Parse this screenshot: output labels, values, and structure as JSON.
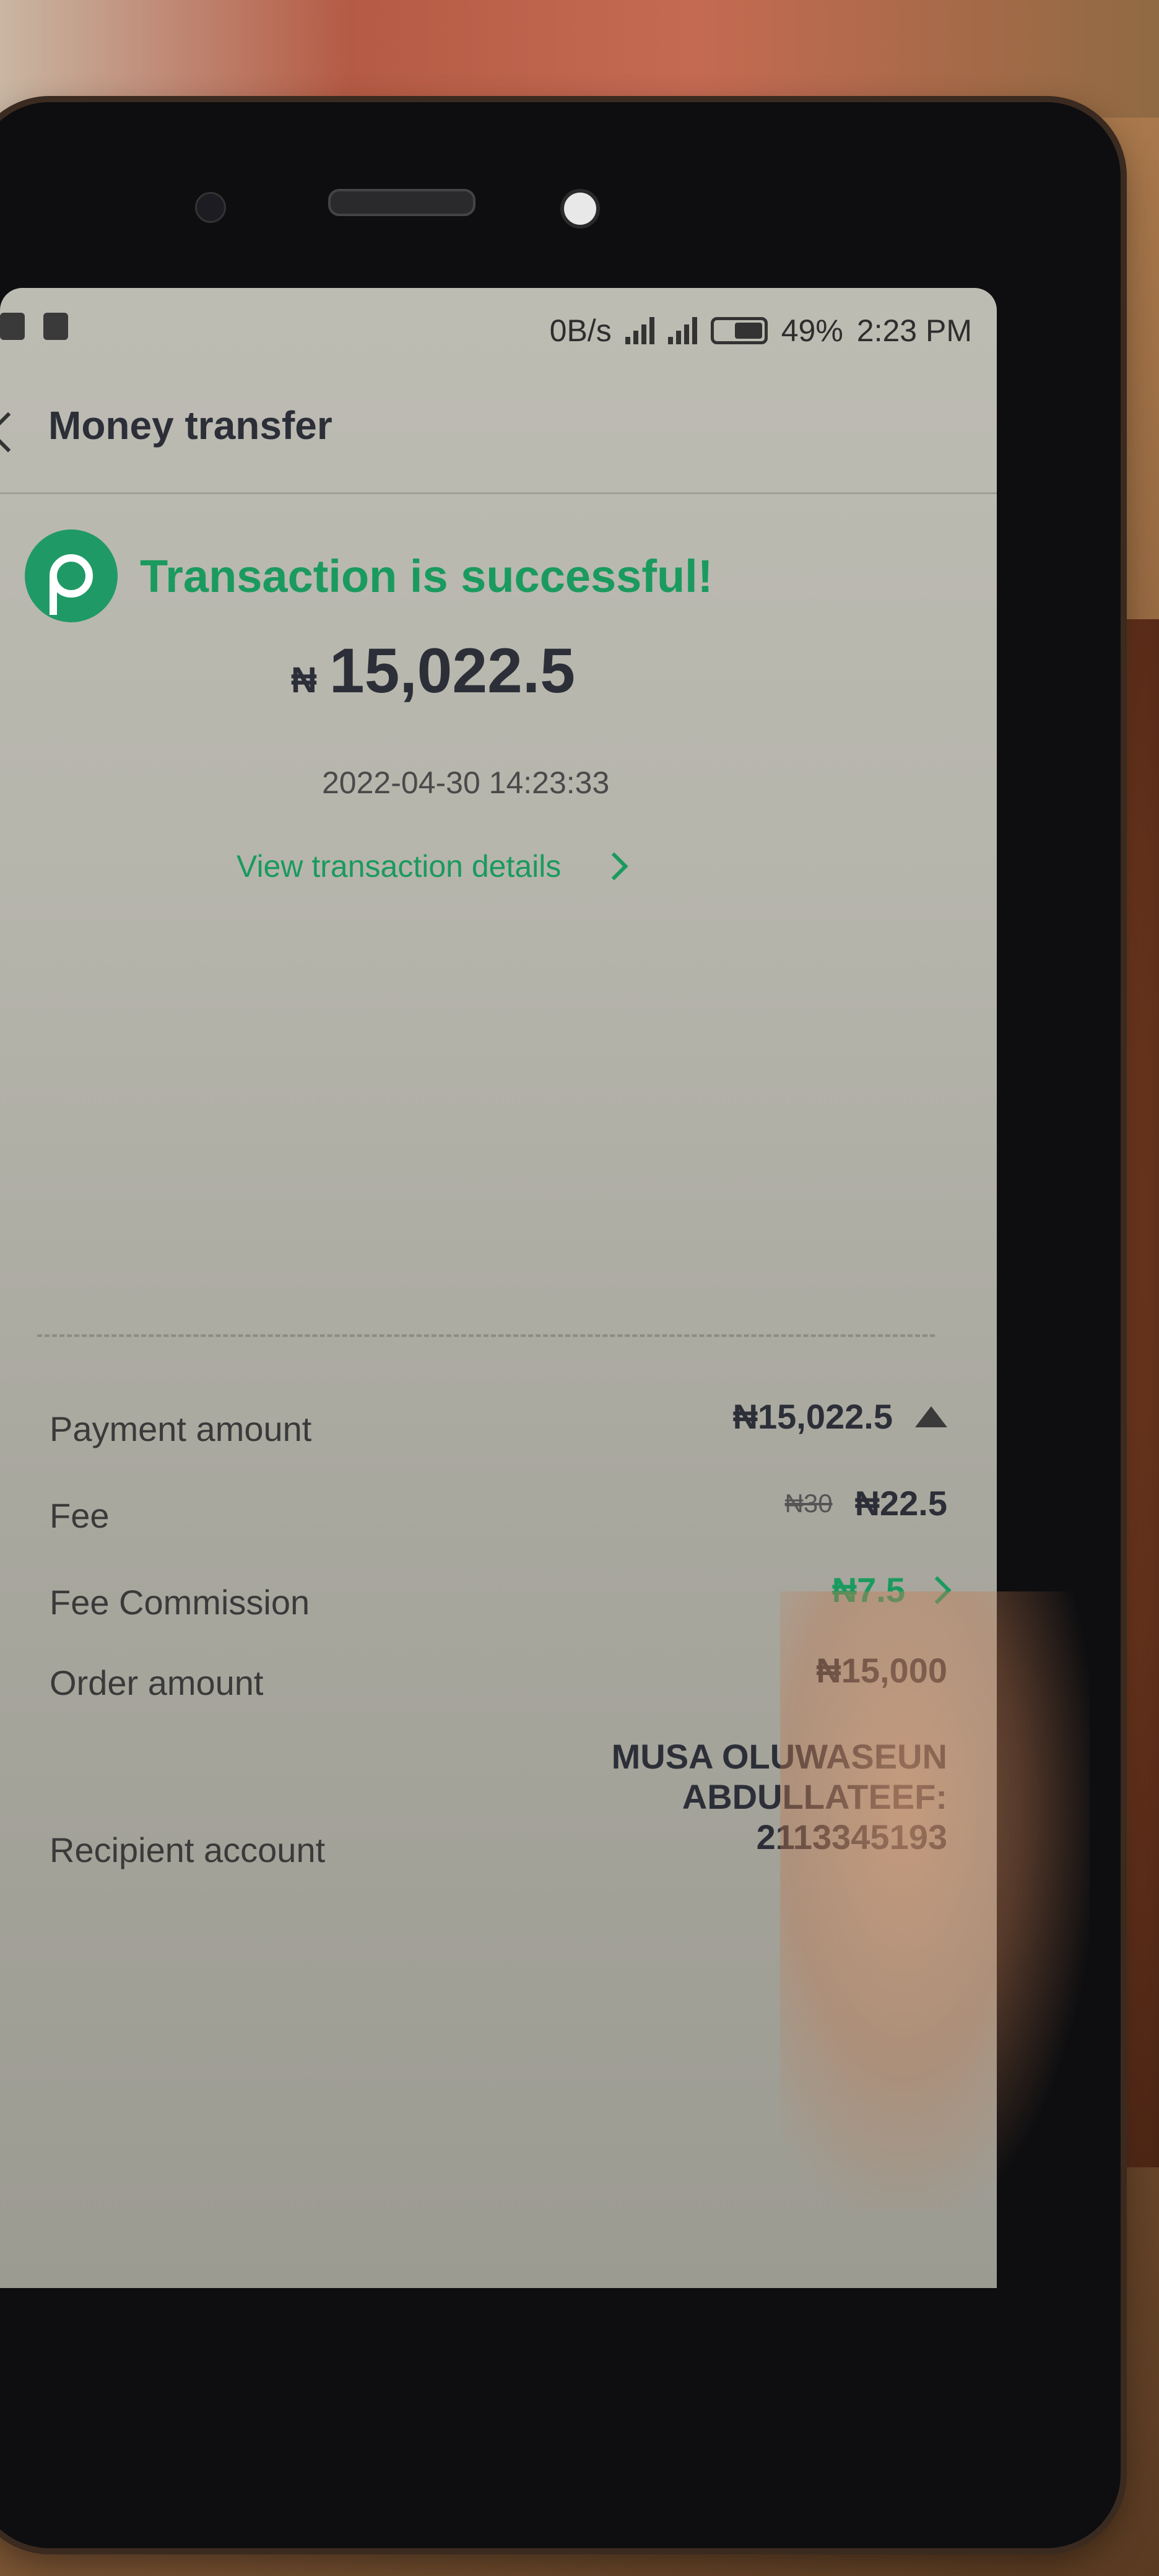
{
  "status_bar": {
    "net_speed": "0B/s",
    "battery": "49%",
    "time": "2:23 PM"
  },
  "header": {
    "title": "Money transfer"
  },
  "receipt": {
    "status": "Transaction is successful!",
    "currency_symbol": "₦",
    "amount": "15,022.5",
    "datetime": "2022-04-30 14:23:33",
    "details_link": "View transaction details"
  },
  "details": {
    "payment_amount": {
      "label": "Payment amount",
      "value": "₦15,022.5"
    },
    "fee": {
      "label": "Fee",
      "original": "₦30",
      "value": "₦22.5"
    },
    "fee_commission": {
      "label": "Fee Commission",
      "value": "₦7.5"
    },
    "order_amount": {
      "label": "Order amount",
      "value": "₦15,000"
    },
    "recipient": {
      "label": "Recipient account",
      "line1": "MUSA OLUWASEUN",
      "line2": "ABDULLATEEF:",
      "line3": "2113345193"
    }
  },
  "colors": {
    "brand_green": "#1a9a5e",
    "text_dark": "#2c2f38"
  },
  "icons": [
    "lock-icon",
    "signal-icon",
    "battery-icon",
    "back-arrow-icon",
    "brand-logo-icon",
    "chevron-right-icon",
    "collapse-triangle-icon",
    "nav-back-icon",
    "nav-home-icon",
    "nav-recent-icon"
  ]
}
